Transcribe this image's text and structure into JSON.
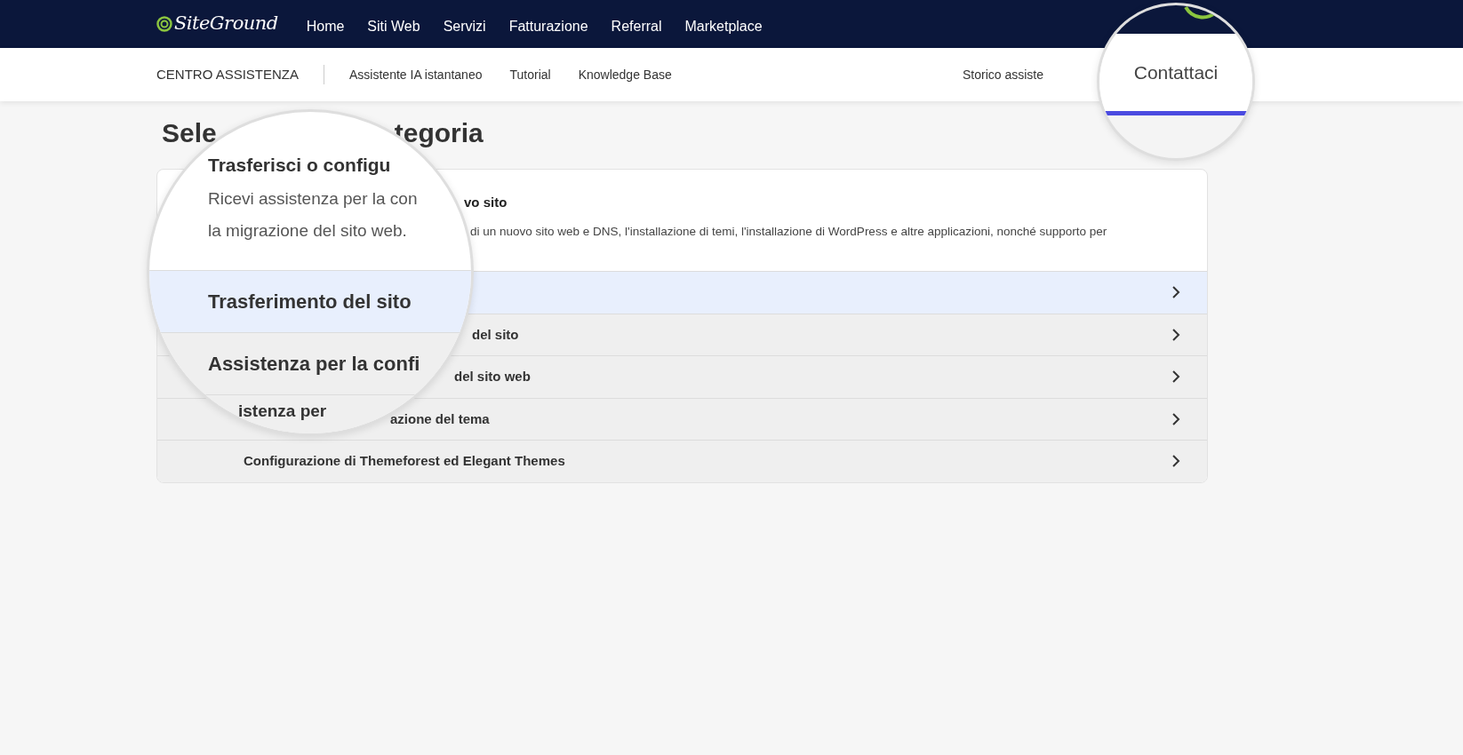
{
  "top_nav": {
    "logo": "SiteGround",
    "items": [
      {
        "label": "Home"
      },
      {
        "label": "Siti Web"
      },
      {
        "label": "Servizi"
      },
      {
        "label": "Fatturazione"
      },
      {
        "label": "Referral"
      },
      {
        "label": "Marketplace"
      }
    ]
  },
  "sub_nav": {
    "title": "CENTRO ASSISTENZA",
    "items": [
      {
        "label": "Assistente IA istantaneo"
      },
      {
        "label": "Tutorial"
      },
      {
        "label": "Knowledge Base"
      }
    ],
    "right_item": "Storico assiste"
  },
  "heading_fragments": [
    "Sele",
    "tegoria"
  ],
  "card": {
    "title_fragment": "vo sito",
    "description_fragment": "di un nuovo sito web e DNS, l'installazione di temi, l'installazione di WordPress e altre applicazioni, nonché supporto per",
    "rows": [
      {
        "selected": true
      },
      {
        "label": "del sito",
        "selected": false
      },
      {
        "label": "del sito web",
        "selected": false
      },
      {
        "label": "azione del tema",
        "selected": false
      },
      {
        "label": "Configurazione di Themeforest ed Elegant Themes",
        "selected": false
      }
    ]
  },
  "magnifier_card": {
    "title": "Trasferisci o configu",
    "description_lines": [
      "Ricevi assistenza per la con",
      "la migrazione del sito web."
    ],
    "rows": [
      {
        "label": "Trasferimento del sito",
        "selected": true
      },
      {
        "label": "Assistenza per la confi",
        "selected": false
      },
      {
        "label": "istenza per",
        "selected": false
      }
    ]
  },
  "magnifier_nav": {
    "tab": {
      "label": "Contattaci",
      "selected": true
    }
  }
}
